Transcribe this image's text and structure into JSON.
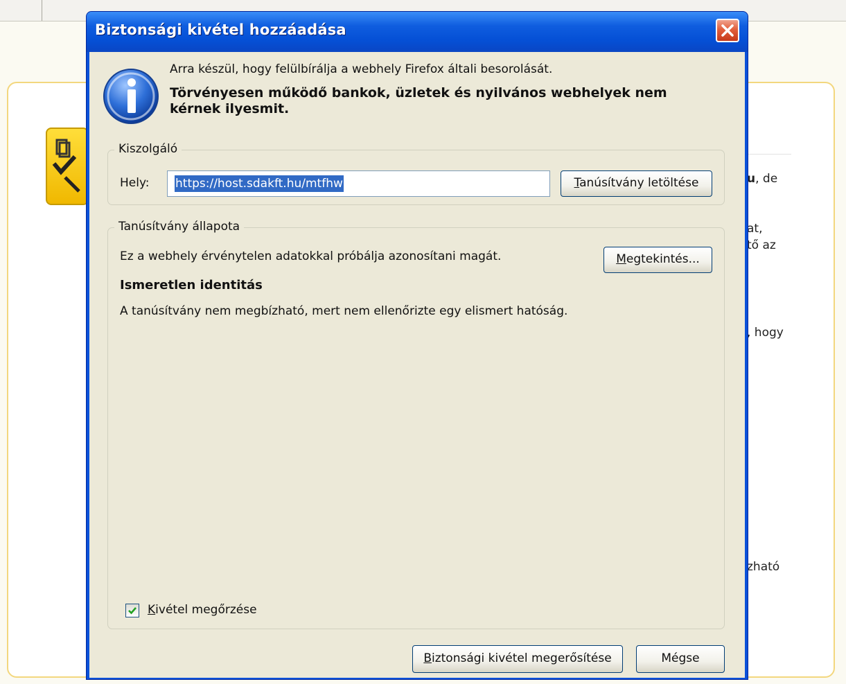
{
  "background": {
    "text_lines": [
      {
        "bold": "u",
        "rest": ", de"
      },
      {
        "bold": "",
        "rest": "at,"
      },
      {
        "bold": "",
        "rest": "tő az"
      },
      {
        "bold": "",
        "rest": ", hogy"
      },
      {
        "bold": "",
        "rest": "zható"
      }
    ]
  },
  "dialog": {
    "title": "Biztonsági kivétel hozzáadása",
    "close_icon": "close-x-icon",
    "header": {
      "icon": "info-icon",
      "message": "Arra készül, hogy felülbírálja a webhely Firefox általi besorolását.",
      "warning": "Törvényesen működő bankok, üzletek és nyilvános webhelyek nem kérnek ilyesmit."
    },
    "server_group": {
      "legend": "Kiszolgáló",
      "location_label": "Hely:",
      "location_value": "https://host.sdakft.hu/mtfhw",
      "get_cert_button": {
        "mnemonic": "T",
        "rest": "anúsítvány letöltése"
      }
    },
    "cert_status_group": {
      "legend": "Tanúsítvány állapota",
      "status_text": "Ez a webhely érvénytelen adatokkal próbálja azonosítani magát.",
      "view_button": {
        "mnemonic": "M",
        "rest": "egtekintés..."
      },
      "issue_title": "Ismeretlen identitás",
      "issue_text": "A tanúsítvány nem megbízható, mert nem ellenőrizte egy elismert hatóság."
    },
    "permanent_checkbox": {
      "checked": true,
      "mnemonic": "K",
      "rest": "ivétel megőrzése"
    },
    "confirm_button": {
      "mnemonic": "B",
      "rest": "iztonsági kivétel megerősítése"
    },
    "cancel_button": "Mégse"
  },
  "colors": {
    "titlebar": "#0550d6",
    "dialog_face": "#ece9d8",
    "selection": "#316ac5",
    "close_button": "#e25f3c"
  }
}
